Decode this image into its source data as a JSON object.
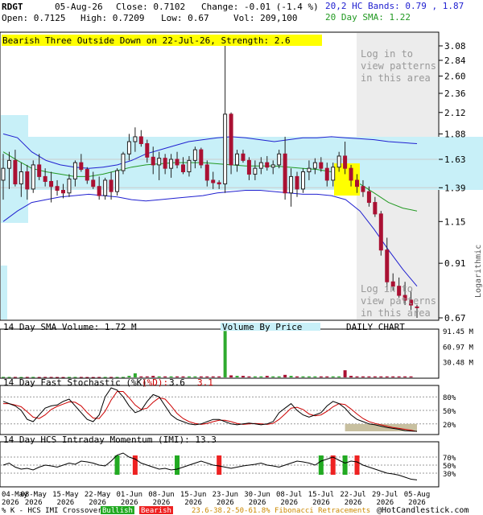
{
  "header": {
    "symbol": "RDGT",
    "date": "05-Aug-26",
    "close": "Close: 0.7102",
    "change": "Change: -0.01 (-1.4 %)",
    "open": "Open: 0.7125",
    "high": "High: 0.7209",
    "low": "Low: 0.67",
    "vol": "Vol: 209,100",
    "bands": "20,2 HC Bands: 0.79 , 1.87",
    "sma": "20 Day SMA: 1.22"
  },
  "pattern_banner": "Bearish Three Outside Down on 22-Jul-26, Strength: 2.6",
  "login_top": [
    "Log in to",
    "view patterns",
    "in this area"
  ],
  "login_bottom": [
    "Log in to",
    "view patterns",
    "in this area"
  ],
  "price_axis": {
    "ticks": [
      "3.08",
      "2.84",
      "2.60",
      "2.36",
      "2.12",
      "1.88",
      "1.63",
      "1.39",
      "1.15",
      "0.91",
      "0.67"
    ],
    "scale_label": "Logarithmic"
  },
  "volume_panel": {
    "title": "14 Day SMA Volume: 1.72 M",
    "vbp_label": "Volume By Price",
    "daily_label": "DAILY CHART",
    "ticks": [
      "91.45 M",
      "60.97 M",
      "30.48 M"
    ]
  },
  "stoch_panel": {
    "title": "14 Day Fast Stochastic (%K)",
    "d_label": "(%D):",
    "k_value": "3.6",
    "d_value": "3.1",
    "ticks": [
      "80%",
      "50%",
      "20%"
    ]
  },
  "imi_panel": {
    "title": "14 Day HCS Intraday Momentum (IMI): 13.3",
    "ticks": [
      "70%",
      "50%",
      "30%"
    ]
  },
  "x_axis": {
    "labels": [
      "04-May",
      "08-May",
      "15-May",
      "22-May",
      "01-Jun",
      "08-Jun",
      "15-Jun",
      "23-Jun",
      "30-Jun",
      "08-Jul",
      "15-Jul",
      "22-Jul",
      "29-Jul",
      "05-Aug"
    ],
    "year": "2026"
  },
  "footer": {
    "crossover": "% K - HCS IMI Crossover:",
    "bullish": "Bullish",
    "bearish": "Bearish",
    "fib": "23.6-38.2-50-61.8% Fibonacci Retracements",
    "copyright": "@HotCandlestick.com"
  },
  "colors": {
    "up": "#2eaa2e",
    "down": "#aa1133",
    "band_fill": "#c8f0f8",
    "band_line": "#2020d0",
    "sma_line": "#229922",
    "banner": "#ffff00",
    "gray_area": "#ececec",
    "stoch_k": "#000000",
    "stoch_d": "#cc0000",
    "oversold_fill": "#c8c0a0",
    "bull_bar": "#22aa22",
    "bear_bar": "#ee2222"
  },
  "chart_data": [
    {
      "type": "candlestick",
      "scale": "log",
      "ylim": [
        0.67,
        3.08
      ],
      "candles": [
        {
          "o": 1.45,
          "h": 1.68,
          "l": 1.3,
          "c": 1.55
        },
        {
          "o": 1.55,
          "h": 1.7,
          "l": 1.38,
          "c": 1.62
        },
        {
          "o": 1.62,
          "h": 1.72,
          "l": 1.4,
          "c": 1.42
        },
        {
          "o": 1.42,
          "h": 1.6,
          "l": 1.32,
          "c": 1.52
        },
        {
          "o": 1.52,
          "h": 1.58,
          "l": 1.3,
          "c": 1.38
        },
        {
          "o": 1.38,
          "h": 1.62,
          "l": 1.35,
          "c": 1.58
        },
        {
          "o": 1.58,
          "h": 1.68,
          "l": 1.45,
          "c": 1.48
        },
        {
          "o": 1.48,
          "h": 1.55,
          "l": 1.4,
          "c": 1.44
        },
        {
          "o": 1.44,
          "h": 1.52,
          "l": 1.28,
          "c": 1.4
        },
        {
          "o": 1.4,
          "h": 1.45,
          "l": 1.33,
          "c": 1.37
        },
        {
          "o": 1.37,
          "h": 1.42,
          "l": 1.31,
          "c": 1.35
        },
        {
          "o": 1.35,
          "h": 1.5,
          "l": 1.32,
          "c": 1.46
        },
        {
          "o": 1.46,
          "h": 1.62,
          "l": 1.4,
          "c": 1.6
        },
        {
          "o": 1.6,
          "h": 1.68,
          "l": 1.52,
          "c": 1.54
        },
        {
          "o": 1.54,
          "h": 1.56,
          "l": 1.42,
          "c": 1.45
        },
        {
          "o": 1.45,
          "h": 1.52,
          "l": 1.38,
          "c": 1.4
        },
        {
          "o": 1.4,
          "h": 1.48,
          "l": 1.3,
          "c": 1.33
        },
        {
          "o": 1.33,
          "h": 1.47,
          "l": 1.3,
          "c": 1.45
        },
        {
          "o": 1.45,
          "h": 1.52,
          "l": 1.3,
          "c": 1.36
        },
        {
          "o": 1.36,
          "h": 1.55,
          "l": 1.33,
          "c": 1.53
        },
        {
          "o": 1.53,
          "h": 1.7,
          "l": 1.5,
          "c": 1.68
        },
        {
          "o": 1.68,
          "h": 1.88,
          "l": 1.62,
          "c": 1.8
        },
        {
          "o": 1.8,
          "h": 1.95,
          "l": 1.7,
          "c": 1.85
        },
        {
          "o": 1.85,
          "h": 1.92,
          "l": 1.75,
          "c": 1.78
        },
        {
          "o": 1.78,
          "h": 1.82,
          "l": 1.6,
          "c": 1.65
        },
        {
          "o": 1.65,
          "h": 1.75,
          "l": 1.5,
          "c": 1.58
        },
        {
          "o": 1.58,
          "h": 1.7,
          "l": 1.45,
          "c": 1.64
        },
        {
          "o": 1.64,
          "h": 1.68,
          "l": 1.5,
          "c": 1.55
        },
        {
          "o": 1.55,
          "h": 1.68,
          "l": 1.47,
          "c": 1.63
        },
        {
          "o": 1.63,
          "h": 1.7,
          "l": 1.55,
          "c": 1.58
        },
        {
          "o": 1.58,
          "h": 1.65,
          "l": 1.5,
          "c": 1.52
        },
        {
          "o": 1.52,
          "h": 1.66,
          "l": 1.48,
          "c": 1.62
        },
        {
          "o": 1.62,
          "h": 1.75,
          "l": 1.55,
          "c": 1.72
        },
        {
          "o": 1.72,
          "h": 1.74,
          "l": 1.55,
          "c": 1.58
        },
        {
          "o": 1.58,
          "h": 1.62,
          "l": 1.4,
          "c": 1.45
        },
        {
          "o": 1.45,
          "h": 1.52,
          "l": 1.38,
          "c": 1.43
        },
        {
          "o": 1.43,
          "h": 1.45,
          "l": 1.38,
          "c": 1.42
        },
        {
          "o": 1.42,
          "h": 3.08,
          "l": 1.35,
          "c": 2.1
        },
        {
          "o": 2.1,
          "h": 2.12,
          "l": 1.5,
          "c": 1.58
        },
        {
          "o": 1.58,
          "h": 1.72,
          "l": 1.52,
          "c": 1.68
        },
        {
          "o": 1.68,
          "h": 1.72,
          "l": 1.6,
          "c": 1.62
        },
        {
          "o": 1.62,
          "h": 1.65,
          "l": 1.45,
          "c": 1.5
        },
        {
          "o": 1.5,
          "h": 1.62,
          "l": 1.45,
          "c": 1.55
        },
        {
          "o": 1.55,
          "h": 1.65,
          "l": 1.5,
          "c": 1.6
        },
        {
          "o": 1.6,
          "h": 1.66,
          "l": 1.53,
          "c": 1.56
        },
        {
          "o": 1.56,
          "h": 1.62,
          "l": 1.5,
          "c": 1.58
        },
        {
          "o": 1.58,
          "h": 1.72,
          "l": 1.55,
          "c": 1.68
        },
        {
          "o": 1.68,
          "h": 1.85,
          "l": 1.3,
          "c": 1.35
        },
        {
          "o": 1.35,
          "h": 1.55,
          "l": 1.25,
          "c": 1.48
        },
        {
          "o": 1.48,
          "h": 1.52,
          "l": 1.32,
          "c": 1.38
        },
        {
          "o": 1.38,
          "h": 1.55,
          "l": 1.35,
          "c": 1.52
        },
        {
          "o": 1.52,
          "h": 1.62,
          "l": 1.45,
          "c": 1.55
        },
        {
          "o": 1.55,
          "h": 1.64,
          "l": 1.5,
          "c": 1.6
        },
        {
          "o": 1.6,
          "h": 1.65,
          "l": 1.52,
          "c": 1.55
        },
        {
          "o": 1.55,
          "h": 1.6,
          "l": 1.4,
          "c": 1.45
        },
        {
          "o": 1.45,
          "h": 1.6,
          "l": 1.4,
          "c": 1.56
        },
        {
          "o": 1.56,
          "h": 1.7,
          "l": 1.52,
          "c": 1.66
        },
        {
          "o": 1.66,
          "h": 1.8,
          "l": 1.5,
          "c": 1.55
        },
        {
          "o": 1.55,
          "h": 1.58,
          "l": 1.4,
          "c": 1.45
        },
        {
          "o": 1.45,
          "h": 1.5,
          "l": 1.35,
          "c": 1.4
        },
        {
          "o": 1.4,
          "h": 1.45,
          "l": 1.32,
          "c": 1.36
        },
        {
          "o": 1.36,
          "h": 1.4,
          "l": 1.25,
          "c": 1.28
        },
        {
          "o": 1.28,
          "h": 1.32,
          "l": 1.18,
          "c": 1.2
        },
        {
          "o": 1.2,
          "h": 1.22,
          "l": 0.95,
          "c": 0.98
        },
        {
          "o": 0.98,
          "h": 1.05,
          "l": 0.78,
          "c": 0.82
        },
        {
          "o": 0.82,
          "h": 0.86,
          "l": 0.78,
          "c": 0.8
        },
        {
          "o": 0.8,
          "h": 0.84,
          "l": 0.75,
          "c": 0.76
        },
        {
          "o": 0.76,
          "h": 0.82,
          "l": 0.72,
          "c": 0.74
        },
        {
          "o": 0.74,
          "h": 0.78,
          "l": 0.7,
          "c": 0.72
        },
        {
          "o": 0.7125,
          "h": 0.7209,
          "l": 0.67,
          "c": 0.7102
        }
      ],
      "upper_band": [
        1.88,
        1.84,
        1.7,
        1.62,
        1.58,
        1.56,
        1.55,
        1.56,
        1.58,
        1.62,
        1.68,
        1.72,
        1.76,
        1.8,
        1.82,
        1.84,
        1.85,
        1.84,
        1.82,
        1.8,
        1.82,
        1.84,
        1.84,
        1.85,
        1.84,
        1.83,
        1.82,
        1.8,
        1.79,
        1.78
      ],
      "lower_band": [
        1.15,
        1.22,
        1.28,
        1.3,
        1.32,
        1.33,
        1.34,
        1.33,
        1.32,
        1.3,
        1.29,
        1.3,
        1.31,
        1.32,
        1.33,
        1.35,
        1.36,
        1.37,
        1.37,
        1.36,
        1.35,
        1.34,
        1.34,
        1.33,
        1.3,
        1.22,
        1.1,
        0.98,
        0.88,
        0.8
      ],
      "sma20": [
        1.7,
        1.62,
        1.55,
        1.52,
        1.5,
        1.48,
        1.48,
        1.5,
        1.53,
        1.56,
        1.58,
        1.59,
        1.6,
        1.6,
        1.6,
        1.59,
        1.58,
        1.57,
        1.57,
        1.57,
        1.56,
        1.55,
        1.54,
        1.52,
        1.48,
        1.42,
        1.35,
        1.28,
        1.24,
        1.22
      ],
      "fib_levels": [
        1.63,
        1.39
      ]
    },
    {
      "type": "bar",
      "name": "volume",
      "ylim": [
        0,
        91.45
      ],
      "values": [
        0,
        0,
        0,
        0,
        0,
        0,
        0,
        0,
        0,
        0,
        0,
        0,
        0,
        0,
        0,
        0,
        0,
        0,
        0,
        0,
        0,
        0,
        0,
        0,
        0,
        0,
        0,
        0,
        0,
        0,
        0,
        0,
        0,
        0,
        0,
        0,
        0,
        0,
        0,
        0,
        0,
        0,
        0,
        0,
        0,
        0,
        0,
        0,
        0,
        0,
        0,
        0,
        0,
        0,
        0,
        0,
        0,
        0,
        0,
        0,
        0,
        0,
        0,
        0,
        0,
        0,
        0,
        0,
        0
      ],
      "values_m": [
        1,
        1,
        1,
        0.8,
        1,
        1,
        0.9,
        1,
        1,
        0.8,
        0.8,
        1,
        1,
        1,
        0.8,
        0.8,
        1,
        1,
        1,
        1,
        1,
        3,
        8,
        2,
        2,
        3,
        2,
        2,
        2,
        2,
        2,
        2,
        2,
        2,
        2,
        2,
        2,
        91,
        4,
        3,
        3,
        2,
        2,
        2,
        3,
        2,
        2,
        5,
        3,
        2,
        2,
        2,
        2,
        2,
        2,
        2,
        2,
        14,
        3,
        2,
        2,
        2,
        2,
        2,
        2,
        2,
        2,
        2,
        2
      ]
    },
    {
      "type": "line",
      "name": "stochastic",
      "ylim": [
        0,
        100
      ],
      "k": [
        70,
        65,
        60,
        50,
        30,
        25,
        40,
        55,
        60,
        62,
        70,
        75,
        60,
        45,
        30,
        25,
        40,
        80,
        100,
        95,
        80,
        60,
        45,
        50,
        70,
        85,
        80,
        60,
        40,
        30,
        25,
        20,
        18,
        20,
        25,
        30,
        30,
        25,
        20,
        18,
        20,
        22,
        20,
        18,
        20,
        25,
        45,
        55,
        65,
        50,
        40,
        35,
        40,
        45,
        60,
        70,
        65,
        55,
        40,
        30,
        25,
        20,
        18,
        15,
        12,
        10,
        8,
        5,
        4,
        3.6
      ],
      "d": [
        65,
        65,
        62,
        58,
        47,
        35,
        32,
        40,
        52,
        59,
        64,
        69,
        68,
        60,
        45,
        33,
        32,
        48,
        73,
        92,
        92,
        78,
        62,
        52,
        55,
        68,
        78,
        75,
        60,
        43,
        32,
        25,
        21,
        19,
        21,
        25,
        28,
        28,
        25,
        21,
        19,
        20,
        21,
        20,
        19,
        21,
        30,
        42,
        55,
        57,
        52,
        42,
        38,
        40,
        48,
        58,
        65,
        63,
        53,
        42,
        32,
        25,
        21,
        18,
        15,
        12,
        10,
        8,
        6,
        3.1
      ]
    },
    {
      "type": "line",
      "name": "imi",
      "ylim": [
        0,
        100
      ],
      "values": [
        50,
        55,
        45,
        40,
        42,
        38,
        45,
        50,
        48,
        45,
        50,
        55,
        52,
        60,
        58,
        55,
        50,
        48,
        60,
        75,
        80,
        70,
        65,
        55,
        50,
        45,
        40,
        42,
        38,
        40,
        45,
        50,
        55,
        60,
        55,
        50,
        48,
        45,
        42,
        45,
        48,
        50,
        52,
        55,
        50,
        48,
        45,
        50,
        55,
        60,
        58,
        55,
        50,
        60,
        65,
        70,
        62,
        55,
        60,
        58,
        50,
        45,
        40,
        35,
        30,
        28,
        25,
        20,
        15,
        13.3
      ],
      "crossovers": [
        {
          "x": 19,
          "type": "bull"
        },
        {
          "x": 22,
          "type": "bear"
        },
        {
          "x": 29,
          "type": "bull"
        },
        {
          "x": 36,
          "type": "bear"
        },
        {
          "x": 53,
          "type": "bull"
        },
        {
          "x": 55,
          "type": "bear"
        },
        {
          "x": 57,
          "type": "bull"
        },
        {
          "x": 59,
          "type": "bear"
        }
      ]
    }
  ]
}
